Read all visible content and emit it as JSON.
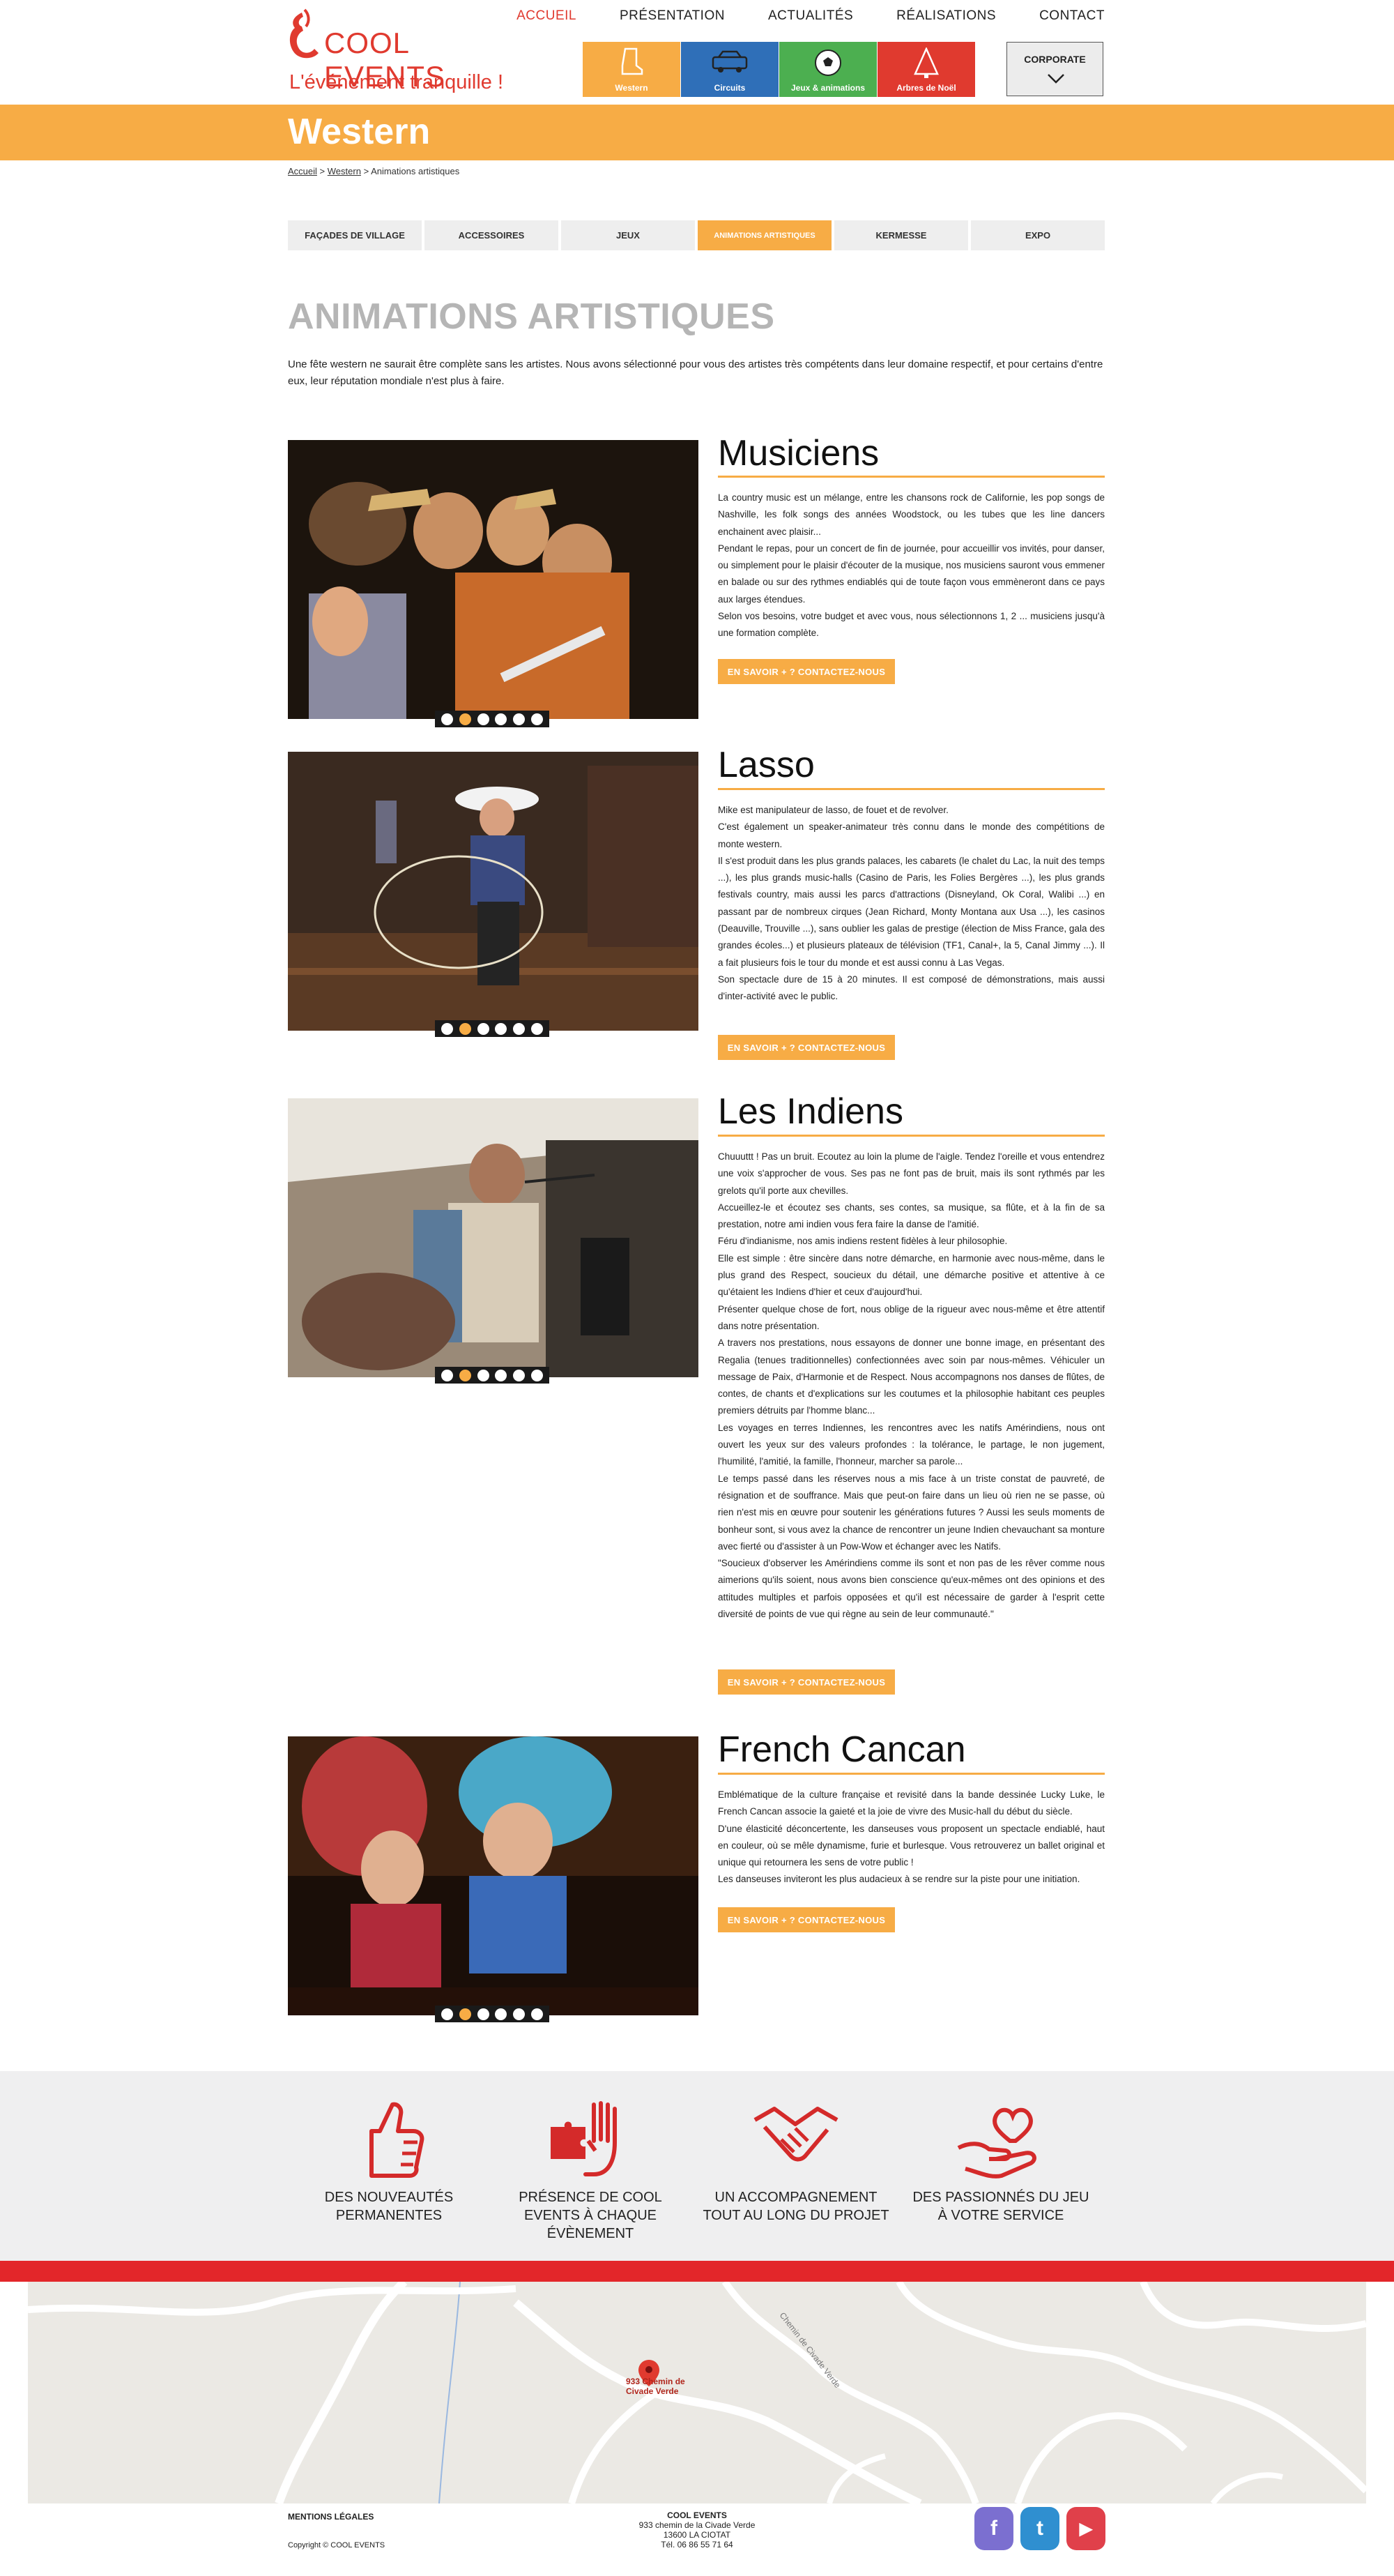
{
  "brand": {
    "name": "COOL EVENTS",
    "tagline": "L'événement tranquille !"
  },
  "nav": {
    "items": [
      {
        "label": "ACCUEIL",
        "active": true
      },
      {
        "label": "PRÉSENTATION",
        "active": false
      },
      {
        "label": "ACTUALITÉS",
        "active": false
      },
      {
        "label": "RÉALISATIONS",
        "active": false
      },
      {
        "label": "CONTACT",
        "active": false
      }
    ]
  },
  "categories": [
    {
      "label": "Western",
      "color": "#f7ac45",
      "icon": "boot-icon"
    },
    {
      "label": "Circuits",
      "color": "#2f6fb8",
      "icon": "car-icon"
    },
    {
      "label": "Jeux & animations",
      "color": "#4caf50",
      "icon": "ball-icon"
    },
    {
      "label": "Arbres de Noël",
      "color": "#e03a2f",
      "icon": "tree-icon"
    }
  ],
  "corporate": {
    "label": "CORPORATE"
  },
  "banner": {
    "title": "Western"
  },
  "breadcrumb": {
    "home": "Accueil",
    "sep": ">",
    "parent": "Western",
    "current": "Animations artistiques"
  },
  "subtabs": [
    {
      "label": "FAÇADES DE VILLAGE",
      "active": false
    },
    {
      "label": "ACCESSOIRES",
      "active": false
    },
    {
      "label": "JEUX",
      "active": false
    },
    {
      "label": "ANIMATIONS ARTISTIQUES",
      "active": true
    },
    {
      "label": "KERMESSE",
      "active": false
    },
    {
      "label": "EXPO",
      "active": false
    }
  ],
  "page": {
    "title": "ANIMATIONS ARTISTIQUES",
    "intro": "Une fête western ne saurait être complète sans les artistes. Nous avons sélectionné pour vous des artistes très compétents dans leur domaine respectif, et pour certains d'entre eux, leur réputation mondiale n'est plus à faire."
  },
  "cta_label": "EN SAVOIR + ? CONTACTEZ-NOUS",
  "sections": [
    {
      "title": "Musiciens",
      "paragraphs": [
        "La country music est un mélange, entre les chansons rock de Californie, les pop songs de Nashville, les folk songs des années Woodstock, ou les tubes que les line dancers enchainent avec plaisir...",
        "Pendant le repas, pour un concert de fin de journée, pour accueillir vos invités, pour danser, ou simplement pour le plaisir d'écouter de la musique, nos musiciens sauront vous emmener en balade ou sur des rythmes endiablés qui de toute façon vous emmèneront dans ce pays aux larges étendues.",
        "Selon vos besoins, votre budget et avec vous, nous sélectionnons 1, 2 ... musiciens jusqu'à une formation complète."
      ]
    },
    {
      "title": "Lasso",
      "paragraphs": [
        "Mike est manipulateur de lasso, de fouet et de revolver.",
        "C'est également un speaker-animateur très connu dans le monde des compétitions de monte western.",
        "Il s'est produit dans les plus grands palaces, les cabarets (le chalet du Lac, la nuit des temps ...), les plus grands music-halls (Casino de Paris, les Folies Bergères ...), les plus grands festivals country, mais aussi les parcs d'attractions (Disneyland, Ok Coral, Walibi ...) en passant par de nombreux cirques (Jean Richard, Monty Montana aux Usa ...), les casinos (Deauville, Trouville ...), sans oublier les galas de prestige (élection de Miss France, gala des grandes écoles...) et plusieurs plateaux de télévision (TF1, Canal+, la 5, Canal Jimmy ...). Il a fait plusieurs fois le tour du monde et est aussi connu à Las Vegas.",
        "Son spectacle dure de 15 à 20 minutes. Il est composé de démonstrations, mais aussi d'inter-activité avec le public."
      ]
    },
    {
      "title": "Les Indiens",
      "paragraphs": [
        "Chuuuttt ! Pas un bruit. Ecoutez au loin la plume de l'aigle. Tendez l'oreille et vous entendrez une voix s'approcher de vous. Ses pas ne font pas de bruit, mais ils sont rythmés par les grelots qu'il porte aux chevilles.",
        "Accueillez-le et écoutez ses chants, ses contes, sa musique, sa flûte, et à la fin de sa prestation, notre ami indien vous fera faire la danse de l'amitié.",
        "Féru d'indianisme, nos amis indiens restent fidèles à leur philosophie.",
        "Elle est simple : être sincère dans notre démarche, en harmonie avec nous-même, dans le plus grand des Respect, soucieux du détail, une démarche positive et attentive à ce qu'étaient les Indiens d'hier et ceux d'aujourd'hui.",
        "Présenter quelque chose de fort, nous oblige de la rigueur avec nous-même et être attentif dans notre présentation.",
        "A travers nos prestations, nous essayons de donner une bonne image, en présentant des Regalia (tenues traditionnelles) confectionnées avec soin par nous-mêmes. Véhiculer un message de Paix, d'Harmonie et de Respect. Nous accompagnons nos danses de flûtes, de contes, de chants et d'explications sur les coutumes et la philosophie habitant ces peuples premiers détruits par l'homme blanc...",
        "Les voyages en terres Indiennes, les rencontres avec les natifs Amérindiens, nous ont ouvert les yeux sur des valeurs profondes : la tolérance, le partage, le non jugement, l'humilité, l'amitié, la famille, l'honneur, marcher sa parole...",
        "Le temps passé dans les réserves nous a mis face à un triste constat de pauvreté, de résignation et de souffrance. Mais que peut-on faire dans un lieu où rien ne se passe, où rien n'est mis en œuvre pour soutenir les générations futures ? Aussi les seuls moments de bonheur sont, si vous avez la chance de rencontrer un jeune Indien chevauchant sa monture avec fierté ou d'assister à un Pow-Wow et échanger avec les Natifs.",
        "\"Soucieux d'observer les Amérindiens comme ils sont et non pas de les rêver comme nous aimerions qu'ils soient, nous avons bien conscience qu'eux-mêmes ont des opinions et des attitudes multiples et parfois opposées et qu'il est nécessaire de garder à l'esprit cette diversité de points de vue qui règne au sein de leur communauté.\""
      ]
    },
    {
      "title": "French Cancan",
      "paragraphs": [
        "Emblématique de la culture française et revisité dans la bande dessinée Lucky Luke, le French Cancan associe la gaieté et la joie de vivre des Music-hall du début du siècle.",
        "D'une élasticité déconcertente, les danseuses vous proposent un spectacle endiablé, haut en couleur, où se mêle dynamisme, furie et burlesque. Vous retrouverez un ballet original et unique qui retournera les sens de votre public !",
        "Les danseuses inviteront les plus audacieux à se rendre sur la piste pour une initiation."
      ]
    }
  ],
  "features": [
    {
      "label": "DES NOUVEAUTÉS PERMANENTES",
      "icon": "thumbs-up-icon"
    },
    {
      "label": "PRÉSENCE DE COOL EVENTS À CHAQUE ÉVÈNEMENT",
      "icon": "puzzle-hand-icon"
    },
    {
      "label": "UN ACCOMPAGNEMENT TOUT AU LONG DU PROJET",
      "icon": "handshake-icon"
    },
    {
      "label": "DES PASSIONNÉS DU JEU À VOTRE SERVICE",
      "icon": "heart-hand-icon"
    }
  ],
  "map": {
    "marker_label": "933 Chemin de Civade Verde",
    "road_label": "Chemin de Civade Verde"
  },
  "footer": {
    "legal": "MENTIONS LÉGALES",
    "copyright": "Copyright © COOL EVENTS",
    "company": "COOL EVENTS",
    "address1": "933 chemin de la Civade Verde",
    "address2": "13600 LA CIOTAT",
    "phone": "Tél. 06 86 55 71 64",
    "socials": [
      {
        "name": "facebook-icon",
        "glyph": "f",
        "color": "#7b6fd0"
      },
      {
        "name": "twitter-icon",
        "glyph": "t",
        "color": "#2f8fd0"
      },
      {
        "name": "youtube-icon",
        "glyph": "▶",
        "color": "#e0404a"
      }
    ]
  }
}
